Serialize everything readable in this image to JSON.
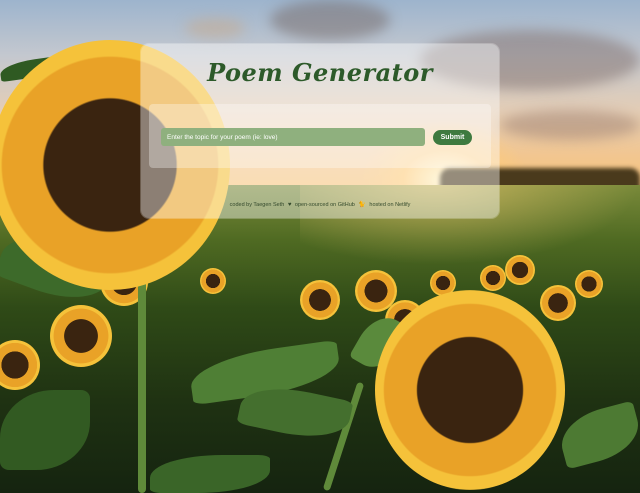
{
  "page": {
    "title": "Poem Generator"
  },
  "form": {
    "input_placeholder": "Enter the topic for your poem (ie: love)",
    "input_value": "",
    "submit_label": "Submit"
  },
  "footer": {
    "coded_by": "coded by Taegen Seth",
    "heart_icon": "♥",
    "open_sourced_text": "open-sourced on GitHub",
    "cat_icon": "🐈",
    "hosted_text": "hosted on Netlify"
  },
  "colors": {
    "title": "#2d5a2a",
    "input_bg": "#8fb07e",
    "button_bg": "#3e7a3f",
    "card_bg": "rgba(255,255,255,0.42)"
  }
}
